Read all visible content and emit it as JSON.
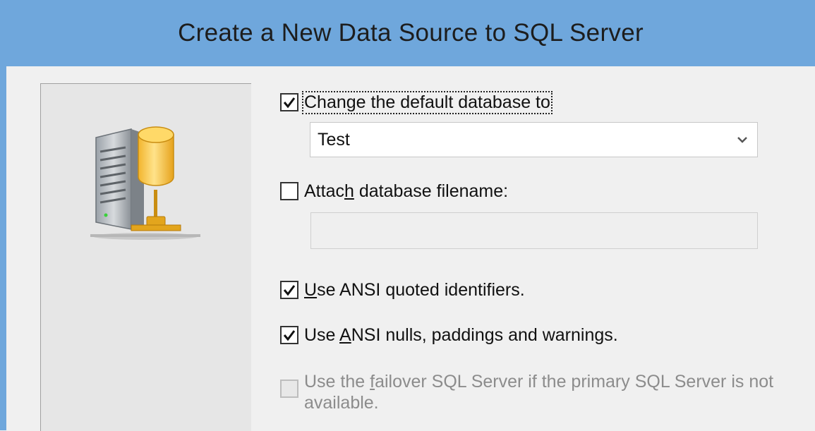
{
  "window": {
    "title": "Create a New Data Source to SQL Server"
  },
  "options": {
    "change_db": {
      "label_pre": "",
      "label_key": "",
      "label_post": "Change the default database to",
      "checked": true
    },
    "database_select": {
      "value": "Test"
    },
    "attach_db": {
      "label_pre": "Attac",
      "label_key": "h",
      "label_post": " database filename:",
      "checked": false
    },
    "attach_filename": {
      "value": ""
    },
    "ansi_quoted": {
      "label_pre": "",
      "label_key": "U",
      "label_post": "se ANSI quoted identifiers.",
      "checked": true
    },
    "ansi_nulls": {
      "label_pre": "Use ",
      "label_key": "A",
      "label_post": "NSI nulls, paddings and warnings.",
      "checked": true
    },
    "failover": {
      "label_pre": "Use the ",
      "label_key": "f",
      "label_post": "ailover SQL Server if the primary SQL Server is not available.",
      "checked": false,
      "disabled": true
    }
  },
  "icons": {
    "server": "database-server-icon",
    "check": "check-icon",
    "dropdown": "chevron-down-icon"
  },
  "colors": {
    "titlebar": "#6fa7dc",
    "dialog_bg": "#f0f0f0",
    "left_panel": "#e6e6e6"
  }
}
